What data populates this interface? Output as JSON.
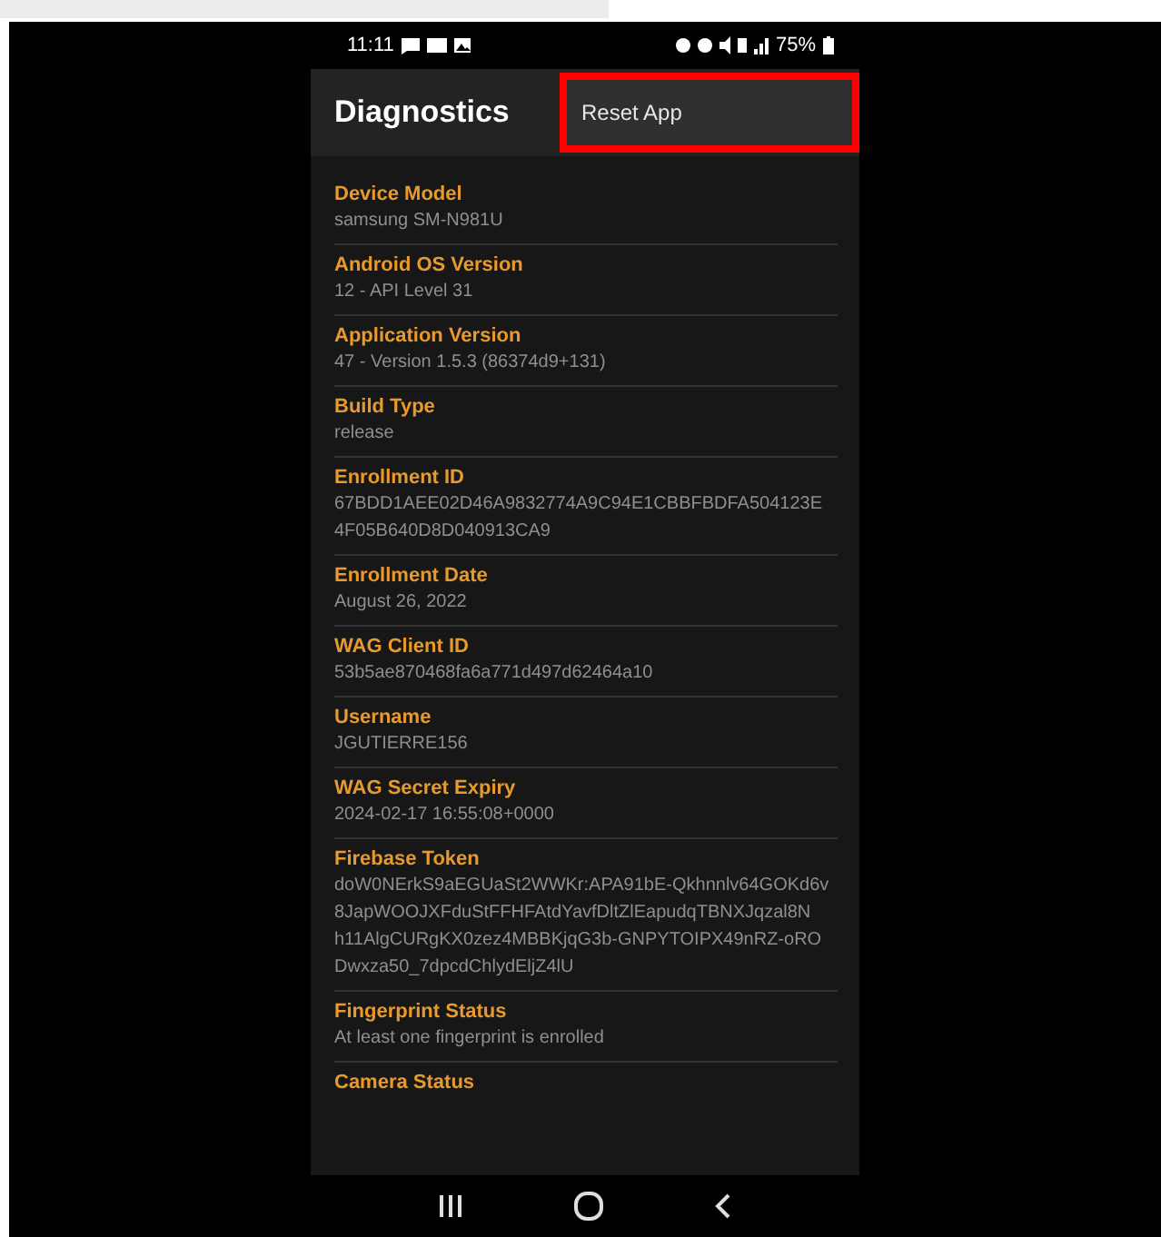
{
  "status_bar": {
    "time": "11:11",
    "battery": "75%"
  },
  "app_bar": {
    "title": "Diagnostics",
    "action": "Reset App",
    "highlighted": true
  },
  "items": [
    {
      "label": "Device Model",
      "lines": [
        "samsung SM-N981U"
      ]
    },
    {
      "label": "Android OS Version",
      "lines": [
        "12 - API Level 31"
      ]
    },
    {
      "label": "Application Version",
      "lines": [
        "47 - Version 1.5.3 (86374d9+131)"
      ]
    },
    {
      "label": "Build Type",
      "lines": [
        "release"
      ]
    },
    {
      "label": "Enrollment ID",
      "lines": [
        "67BDD1AEE02D46A9832774A9C94E1CBBFBDFA504123E",
        "4F05B640D8D040913CA9"
      ]
    },
    {
      "label": "Enrollment Date",
      "lines": [
        "August 26, 2022"
      ]
    },
    {
      "label": "WAG Client ID",
      "lines": [
        "53b5ae870468fa6a771d497d62464a10"
      ]
    },
    {
      "label": "Username",
      "lines": [
        "JGUTIERRE156"
      ]
    },
    {
      "label": "WAG Secret Expiry",
      "lines": [
        "2024-02-17 16:55:08+0000"
      ]
    },
    {
      "label": "Firebase Token",
      "lines": [
        "doW0NErkS9aEGUaSt2WWKr:APA91bE-Qkhnnlv64GOKd6v",
        "8JapWOOJXFduStFFHFAtdYavfDltZlEapudqTBNXJqzal8N",
        "h11AlgCURgKX0zez4MBBKjqG3b-GNPYTOIPX49nRZ-oRO",
        "Dwxza50_7dpcdChlydEljZ4lU"
      ]
    },
    {
      "label": "Fingerprint Status",
      "lines": [
        "At least one fingerprint is enrolled"
      ]
    },
    {
      "label": "Camera Status"
    }
  ]
}
